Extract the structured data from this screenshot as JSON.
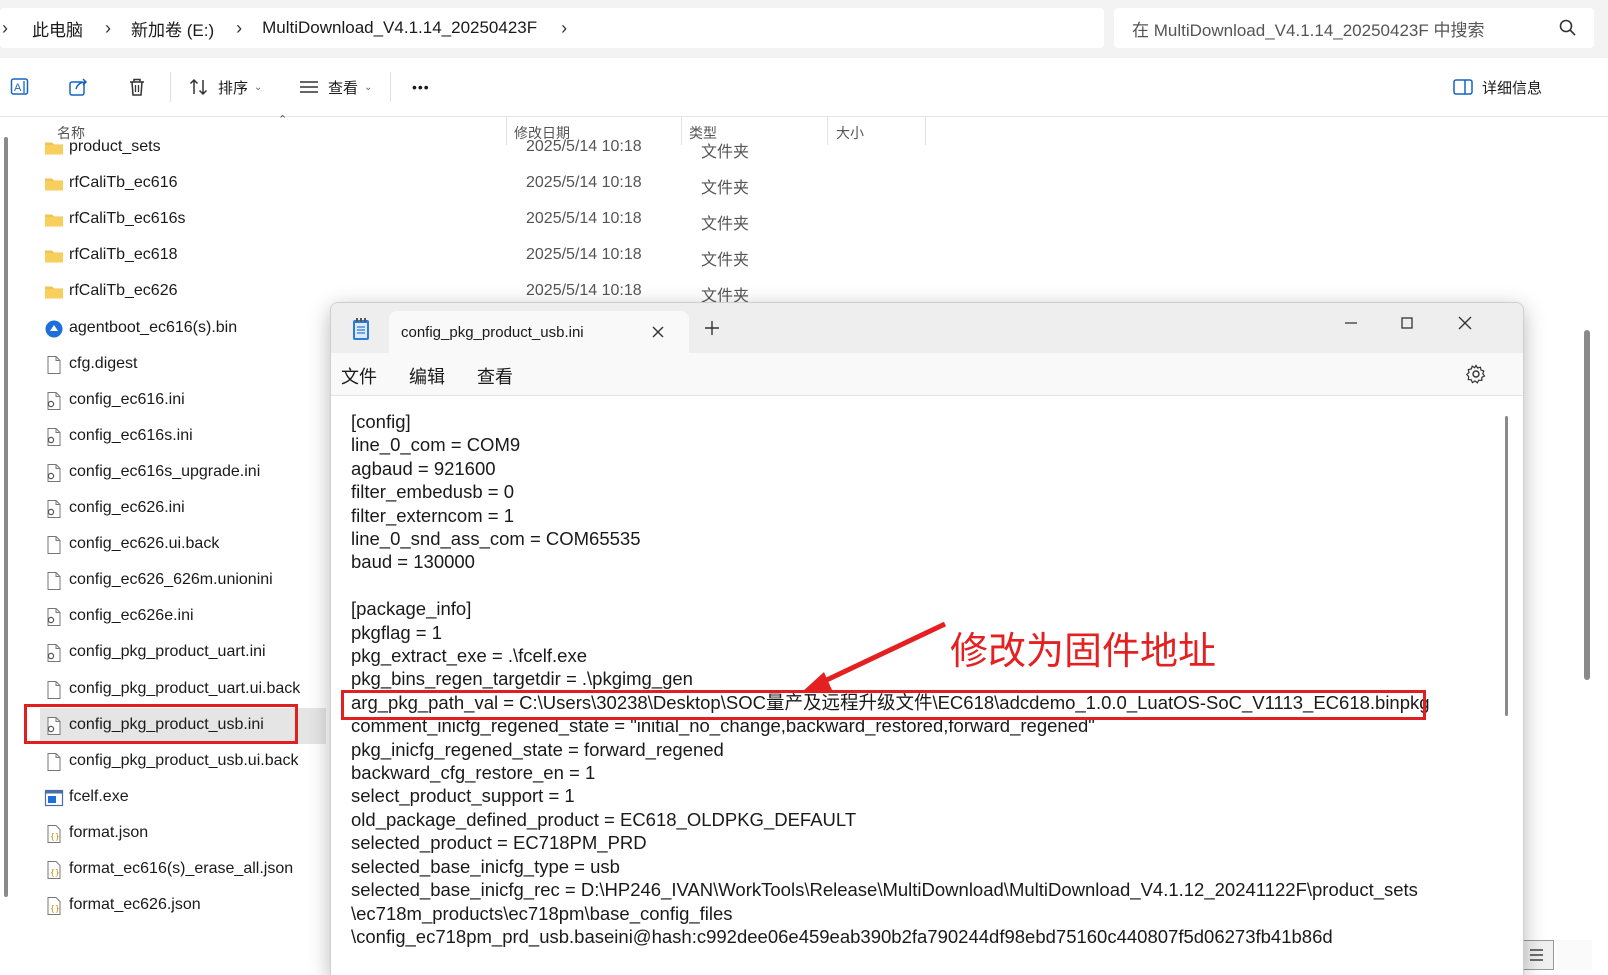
{
  "address": {
    "crumbs": [
      "此电脑",
      "新加卷 (E:)",
      "MultiDownload_V4.1.14_20250423F"
    ],
    "search_placeholder": "在 MultiDownload_V4.1.14_20250423F 中搜索"
  },
  "toolbar": {
    "sort_label": "排序",
    "view_label": "查看",
    "more_label": "•••",
    "details_label": "详细信息"
  },
  "columns": {
    "name": "名称",
    "modified": "修改日期",
    "type": "类型",
    "size": "大小"
  },
  "files": [
    {
      "name": "product_sets",
      "date": "2025/5/14 10:18",
      "type": "文件夹",
      "icon": "folder-icon"
    },
    {
      "name": "rfCaliTb_ec616",
      "date": "2025/5/14 10:18",
      "type": "文件夹",
      "icon": "folder-icon"
    },
    {
      "name": "rfCaliTb_ec616s",
      "date": "2025/5/14 10:18",
      "type": "文件夹",
      "icon": "folder-icon"
    },
    {
      "name": "rfCaliTb_ec618",
      "date": "2025/5/14 10:18",
      "type": "文件夹",
      "icon": "folder-icon"
    },
    {
      "name": "rfCaliTb_ec626",
      "date": "2025/5/14 10:18",
      "type": "文件夹",
      "icon": "folder-icon"
    },
    {
      "name": "agentboot_ec616(s).bin",
      "date": "",
      "type": "",
      "icon": "bin-file-icon"
    },
    {
      "name": "cfg.digest",
      "date": "",
      "type": "",
      "icon": "file-icon"
    },
    {
      "name": "config_ec616.ini",
      "date": "",
      "type": "",
      "icon": "ini-file-icon"
    },
    {
      "name": "config_ec616s.ini",
      "date": "",
      "type": "",
      "icon": "ini-file-icon"
    },
    {
      "name": "config_ec616s_upgrade.ini",
      "date": "",
      "type": "",
      "icon": "ini-file-icon"
    },
    {
      "name": "config_ec626.ini",
      "date": "",
      "type": "",
      "icon": "ini-file-icon"
    },
    {
      "name": "config_ec626.ui.back",
      "date": "",
      "type": "",
      "icon": "file-icon"
    },
    {
      "name": "config_ec626_626m.unionini",
      "date": "",
      "type": "",
      "icon": "file-icon"
    },
    {
      "name": "config_ec626e.ini",
      "date": "",
      "type": "",
      "icon": "ini-file-icon"
    },
    {
      "name": "config_pkg_product_uart.ini",
      "date": "",
      "type": "",
      "icon": "ini-file-icon"
    },
    {
      "name": "config_pkg_product_uart.ui.back",
      "date": "",
      "type": "",
      "icon": "file-icon"
    },
    {
      "name": "config_pkg_product_usb.ini",
      "date": "",
      "type": "",
      "icon": "ini-file-icon",
      "selected": true
    },
    {
      "name": "config_pkg_product_usb.ui.back",
      "date": "",
      "type": "",
      "icon": "file-icon"
    },
    {
      "name": "fcelf.exe",
      "date": "",
      "type": "",
      "icon": "exe-file-icon"
    },
    {
      "name": "format.json",
      "date": "",
      "type": "",
      "icon": "json-file-icon"
    },
    {
      "name": "format_ec616(s)_erase_all.json",
      "date": "",
      "type": "",
      "icon": "json-file-icon"
    },
    {
      "name": "format_ec626.json",
      "date": "",
      "type": "",
      "icon": "json-file-icon"
    }
  ],
  "notepad": {
    "tab_title": "config_pkg_product_usb.ini",
    "menus": [
      "文件",
      "编辑",
      "查看"
    ],
    "lines": [
      "[config]",
      "line_0_com = COM9",
      "agbaud = 921600",
      "filter_embedusb = 0",
      "filter_externcom = 1",
      "line_0_snd_ass_com = COM65535",
      "baud = 130000",
      "",
      "[package_info]",
      "pkgflag = 1",
      "pkg_extract_exe = .\\fcelf.exe",
      "pkg_bins_regen_targetdir = .\\pkgimg_gen",
      "arg_pkg_path_val = C:\\Users\\30238\\Desktop\\SOC量产及远程升级文件\\EC618\\adcdemo_1.0.0_LuatOS-SoC_V1113_EC618.binpkg",
      "comment_inicfg_regened_state = \"initial_no_change,backward_restored,forward_regened\"",
      "pkg_inicfg_regened_state = forward_regened",
      "backward_cfg_restore_en = 1",
      "select_product_support = 1",
      "old_package_defined_product = EC618_OLDPKG_DEFAULT",
      "selected_product = EC718PM_PRD",
      "selected_base_inicfg_type = usb",
      "selected_base_inicfg_rec = D:\\HP246_IVAN\\WorkTools\\Release\\MultiDownload\\MultiDownload_V4.1.12_20241122F\\product_sets",
      "\\ec718m_products\\ec718pm\\base_config_files",
      "\\config_ec718pm_prd_usb.baseini@hash:c992dee06e459eab390b2fa790244df98ebd75160c440807f5d06273fb41b86d"
    ]
  },
  "annotation": {
    "text": "修改为固件地址",
    "color": "#e42020"
  }
}
